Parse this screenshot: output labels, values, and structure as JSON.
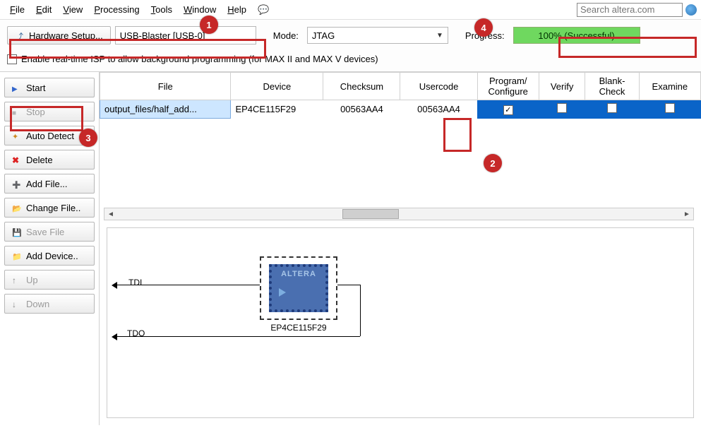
{
  "menu": {
    "file": "File",
    "edit": "Edit",
    "view": "View",
    "processing": "Processing",
    "tools": "Tools",
    "window": "Window",
    "help": "Help"
  },
  "search": {
    "placeholder": "Search altera.com"
  },
  "toolbar": {
    "hardware_setup": "Hardware Setup...",
    "hardware_value": "USB-Blaster [USB-0]",
    "mode_label": "Mode:",
    "mode_value": "JTAG",
    "progress_label": "Progress:",
    "progress_value": "100% (Successful)"
  },
  "realtime_isp": {
    "label": "Enable real-time ISP to allow background programming (for MAX II and MAX V devices)",
    "checked": false
  },
  "side_buttons": {
    "start": "Start",
    "stop": "Stop",
    "auto_detect": "Auto Detect",
    "delete": "Delete",
    "add_file": "Add File...",
    "change_file": "Change File..",
    "save_file": "Save File",
    "add_device": "Add Device..",
    "up": "Up",
    "down": "Down"
  },
  "grid": {
    "columns": {
      "file": "File",
      "device": "Device",
      "checksum": "Checksum",
      "usercode": "Usercode",
      "program": "Program/\nConfigure",
      "verify": "Verify",
      "blank": "Blank-\nCheck",
      "examine": "Examine"
    },
    "row": {
      "file": "output_files/half_add...",
      "device": "EP4CE115F29",
      "checksum": "00563AA4",
      "usercode": "00563AA4",
      "program": true,
      "verify": false,
      "blank": false,
      "examine": false
    }
  },
  "chain": {
    "tdi": "TDI",
    "tdo": "TDO",
    "chip_brand": "ALTERA",
    "chip_device": "EP4CE115F29"
  },
  "annotations": {
    "b1": "1",
    "b2": "2",
    "b3": "3",
    "b4": "4"
  }
}
